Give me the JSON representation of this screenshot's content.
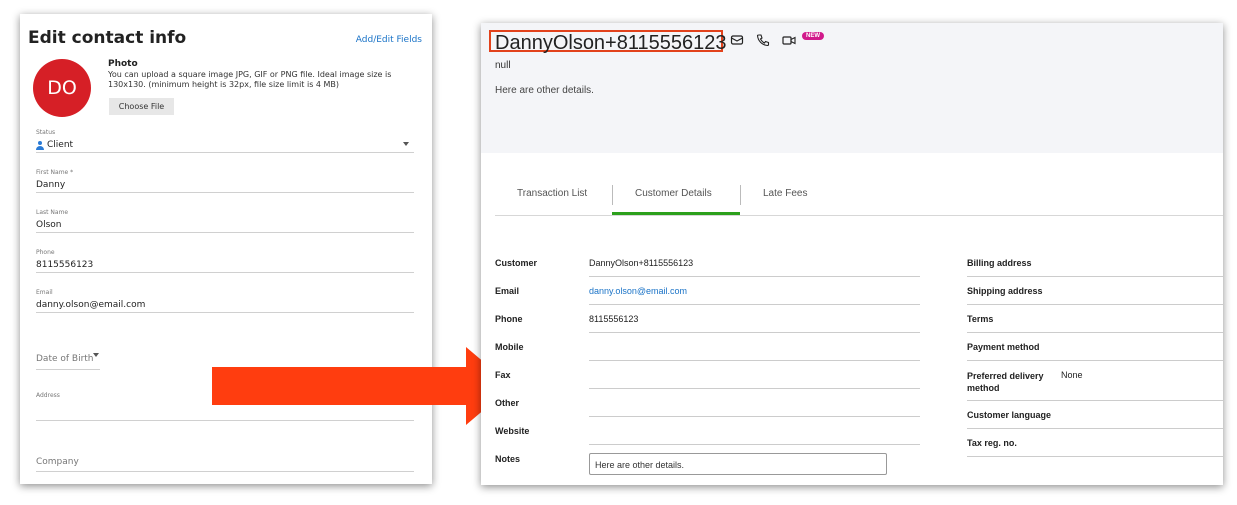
{
  "left_panel": {
    "title": "Edit contact info",
    "add_edit_fields": "Add/Edit Fields",
    "avatar_initials": "DO",
    "photo_title": "Photo",
    "photo_desc": "You can upload a square image JPG, GIF or PNG file. Ideal image size is 130x130. (minimum height is 32px, file size limit is 4 MB)",
    "choose_file": "Choose File",
    "status_label": "Status",
    "status_value": "Client",
    "first_name_label": "First Name *",
    "first_name_value": "Danny",
    "last_name_label": "Last Name",
    "last_name_value": "Olson",
    "phone_label": "Phone",
    "phone_value": "8115556123",
    "email_label": "Email",
    "email_value": "danny.olson@email.com",
    "dob_placeholder": "Date of Birth",
    "address_label": "Address",
    "company_placeholder": "Company"
  },
  "right_panel": {
    "customer_name": "DannyOlson+8115556123",
    "new_badge": "NEW",
    "null_text": "null",
    "header_notes": "Here are other details.",
    "tabs": [
      {
        "label": "Transaction List"
      },
      {
        "label": "Customer Details"
      },
      {
        "label": "Late Fees"
      }
    ],
    "details_left": [
      {
        "key": "Customer",
        "value": "DannyOlson+8115556123"
      },
      {
        "key": "Email",
        "value": "danny.olson@email.com"
      },
      {
        "key": "Phone",
        "value": "8115556123"
      },
      {
        "key": "Mobile",
        "value": ""
      },
      {
        "key": "Fax",
        "value": ""
      },
      {
        "key": "Other",
        "value": ""
      },
      {
        "key": "Website",
        "value": ""
      },
      {
        "key": "Notes",
        "value": "Here are other details."
      }
    ],
    "details_right": [
      {
        "key": "Billing address",
        "value": ""
      },
      {
        "key": "Shipping address",
        "value": ""
      },
      {
        "key": "Terms",
        "value": ""
      },
      {
        "key": "Payment method",
        "value": ""
      },
      {
        "key": "Preferred delivery method",
        "value": "None"
      },
      {
        "key": "Customer language",
        "value": ""
      },
      {
        "key": "Tax reg. no.",
        "value": ""
      }
    ]
  },
  "colors": {
    "avatar_bg": "#d61f26",
    "arrow": "#ff3d0f",
    "highlight_box": "#e2421c",
    "tab_active": "#2ca01c",
    "link": "#1a73c7",
    "new_badge": "#d11a8b"
  },
  "icons": [
    "person-icon",
    "caret-down-icon",
    "mail-icon",
    "phone-icon",
    "video-icon",
    "arrow-right-icon"
  ]
}
